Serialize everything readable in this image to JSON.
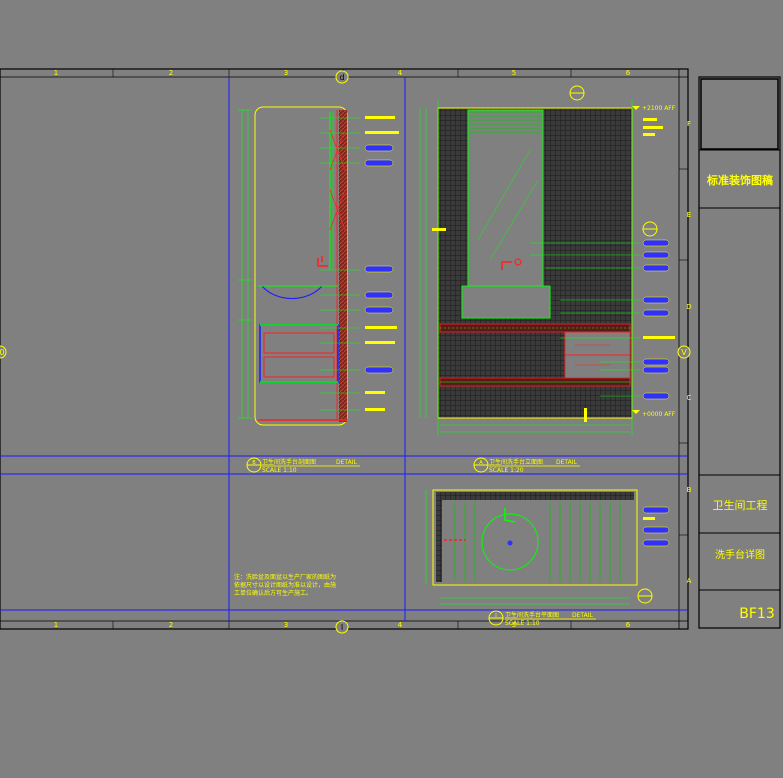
{
  "title_block": {
    "company": "标准装饰图稿",
    "project": "卫生间工程",
    "drawing_name": "洗手台详图",
    "sheet_no": "BF13"
  },
  "grid": {
    "columns": [
      "1",
      "2",
      "3",
      "4",
      "5",
      "6"
    ],
    "rows": [
      "F",
      "E",
      "D",
      "C",
      "B",
      "A"
    ]
  },
  "markers": {
    "top_center": "d",
    "bottom_center": "I",
    "left_middle": "0",
    "right_middle": "V"
  },
  "views": [
    {
      "marker": "B",
      "title": "卫生间洗手台剖面图",
      "suffix": "DETAIL",
      "scale": "SCALE 1:10"
    },
    {
      "marker": "A",
      "title": "卫生间洗手台立面图",
      "suffix": "DETAIL",
      "scale": "SCALE 1:20"
    },
    {
      "marker": "I",
      "title": "卫生间洗手台平面图",
      "suffix": "DETAIL",
      "scale": "SCALE 1:10"
    }
  ],
  "levels": {
    "top": "+2100  AFF",
    "bottom": "+0000  AFF"
  },
  "note": {
    "line1": "注：洗脸盆及面盆以生产厂家的图纸为",
    "line2": "依据尺寸以设计图纸为准以设计，由施",
    "line3": "工单位确认后方可生产施工。"
  },
  "colors": {
    "background": "#808080",
    "frame": "#000000",
    "grid_line": "#1a1aff",
    "annotation": "#ffff00",
    "geometry": "#00ff00",
    "tile": "#2a2a2a",
    "cut": "#ff2020",
    "tag": "#3030ff"
  }
}
